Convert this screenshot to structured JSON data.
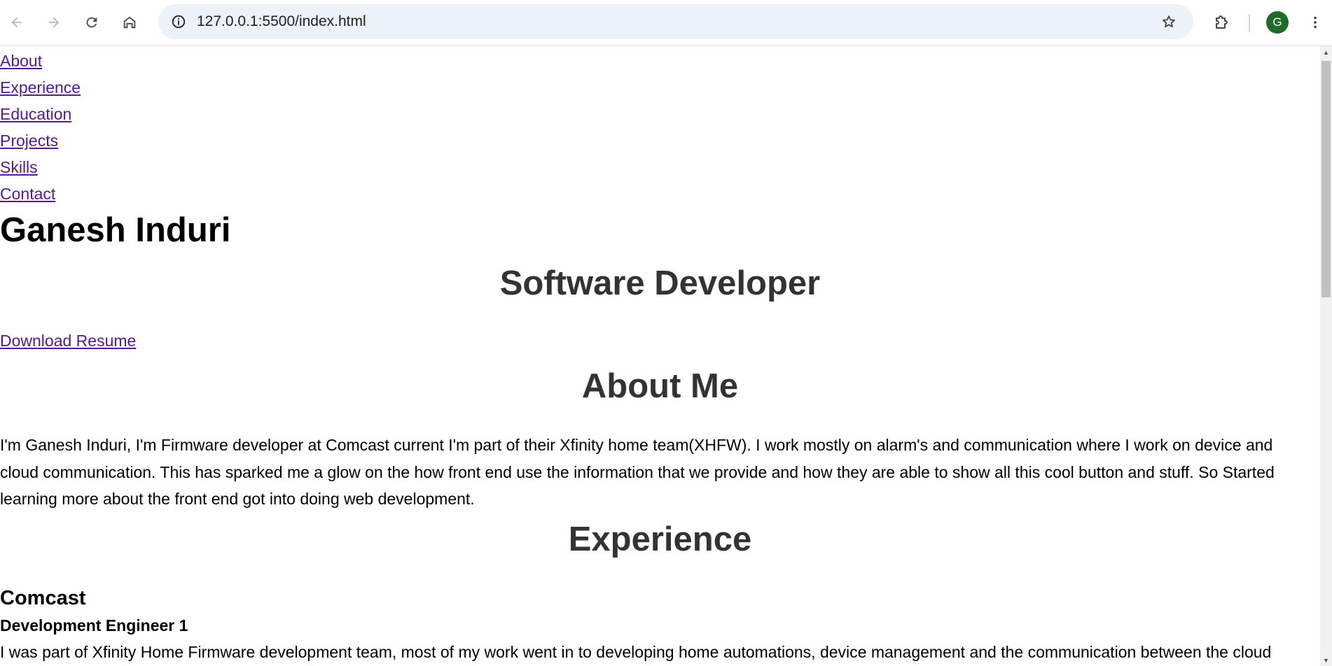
{
  "browser": {
    "url": "127.0.0.1:5500/index.html",
    "profile_initial": "G",
    "icons": [
      "back-icon",
      "forward-icon",
      "reload-icon",
      "home-icon",
      "site-info-icon",
      "bookmark-star-icon",
      "extensions-icon",
      "more-menu-icon"
    ]
  },
  "nav": {
    "items": [
      "About",
      "Experience",
      "Education",
      "Projects",
      "Skills",
      "Contact"
    ]
  },
  "header": {
    "name": "Ganesh Induri",
    "subtitle": "Software Developer",
    "resume_link": "Download Resume"
  },
  "about": {
    "title": "About Me",
    "text": "I'm Ganesh Induri, I'm Firmware developer at Comcast current I'm part of their Xfinity home team(XHFW). I work mostly on alarm's and communication where I work on device and cloud communication. This has sparked me a glow on the how front end use the information that we provide and how they are able to show all this cool button and stuff. So Started learning more about the front end got into doing web development."
  },
  "experience": {
    "title": "Experience",
    "company": "Comcast",
    "role": "Development Engineer 1",
    "description": "I was part of Xfinity Home Firmware development team, most of my work went in to developing home automations, device management and the communication between the cloud"
  },
  "colors": {
    "link_visited": "#551a8b",
    "heading_gray": "#333333",
    "omnibox_bg": "#edf2fa",
    "avatar_bg": "#1e6b2b"
  }
}
